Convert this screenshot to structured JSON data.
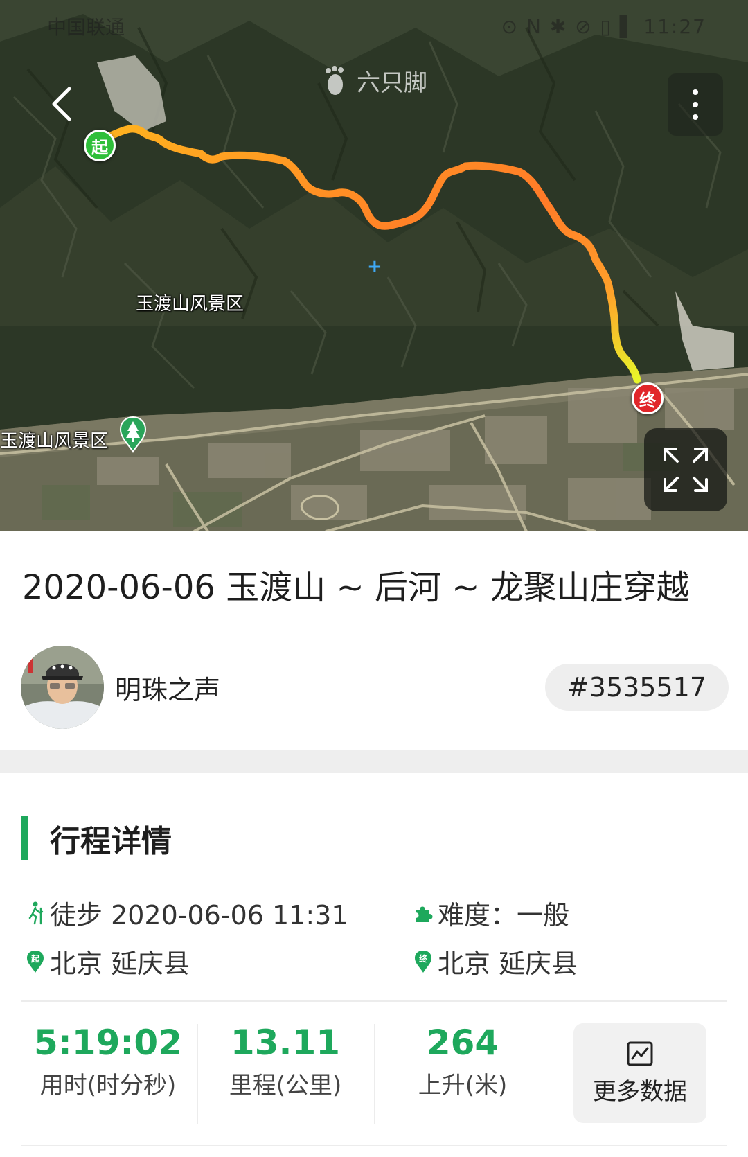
{
  "statusbar": {
    "carrier": "中国联通",
    "right_text": "⊙ N ✱ ⊘ ▯ ▌ 11:27"
  },
  "map": {
    "brand_name": "六只脚",
    "place_label_1": "玉渡山风景区",
    "place_label_2": "玉渡山风景区",
    "start_marker": "起",
    "end_marker": "终",
    "route_colors": {
      "start": "#ffb21f",
      "mid": "#ff7a28",
      "end": "#e8f52a"
    }
  },
  "track": {
    "title": "2020-06-06 玉渡山 ~ 后河 ~ 龙聚山庄穿越",
    "author": "明珠之声",
    "id": "#3535517"
  },
  "details": {
    "section_title": "行程详情",
    "activity": "徒步 2020-06-06 11:31",
    "difficulty": "难度：一般",
    "start_place": "北京 延庆县",
    "end_place": "北京 延庆县"
  },
  "stats": {
    "duration_value": "5:19:02",
    "duration_label": "用时(时分秒)",
    "distance_value": "13.11",
    "distance_label": "里程(公里)",
    "ascent_value": "264",
    "ascent_label": "上升(米)",
    "more_label": "更多数据"
  },
  "colors": {
    "accent": "#1ea85c",
    "start": "#2fbf3a",
    "end": "#e1262a"
  }
}
